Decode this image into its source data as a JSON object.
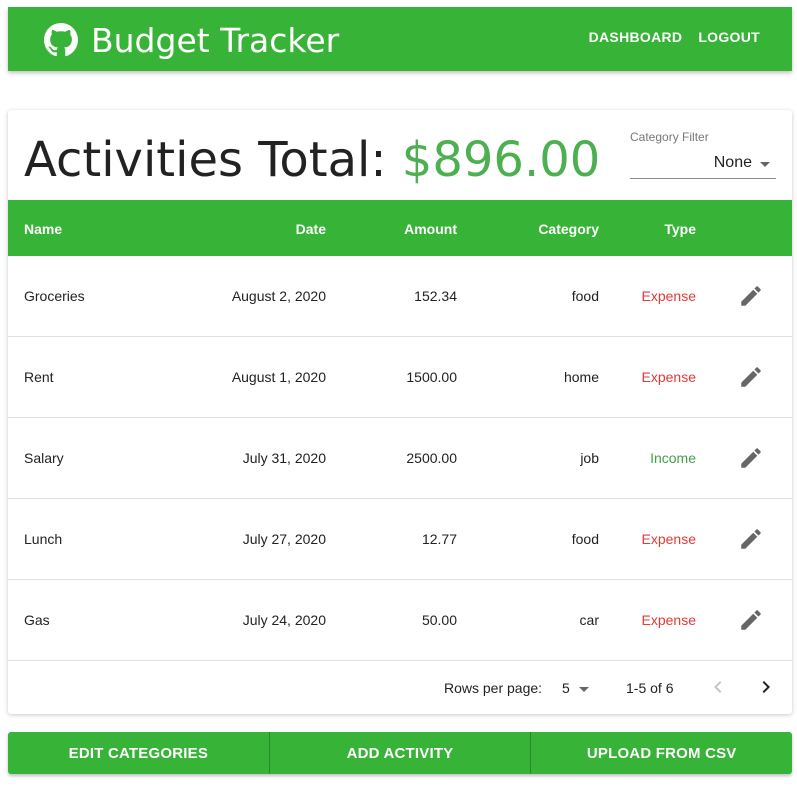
{
  "header": {
    "title": "Budget Tracker",
    "logo_icon": "github-icon",
    "nav": [
      "DASHBOARD",
      "LOGOUT"
    ],
    "color": "#37b337"
  },
  "summary": {
    "label": "Activities Total:",
    "amount": "$896.00",
    "amount_color": "#4caf50"
  },
  "filter": {
    "label": "Category Filter",
    "value": "None"
  },
  "table": {
    "columns": [
      "Name",
      "Date",
      "Amount",
      "Category",
      "Type"
    ],
    "rows": [
      {
        "name": "Groceries",
        "date": "August 2, 2020",
        "amount": "152.34",
        "category": "food",
        "type": "Expense"
      },
      {
        "name": "Rent",
        "date": "August 1, 2020",
        "amount": "1500.00",
        "category": "home",
        "type": "Expense"
      },
      {
        "name": "Salary",
        "date": "July 31, 2020",
        "amount": "2500.00",
        "category": "job",
        "type": "Income"
      },
      {
        "name": "Lunch",
        "date": "July 27, 2020",
        "amount": "12.77",
        "category": "food",
        "type": "Expense"
      },
      {
        "name": "Gas",
        "date": "July 24, 2020",
        "amount": "50.00",
        "category": "car",
        "type": "Expense"
      }
    ],
    "edit_icon": "pencil-icon",
    "type_colors": {
      "Expense": "#e53935",
      "Income": "#43a047"
    }
  },
  "pagination": {
    "rows_per_page_label": "Rows per page:",
    "rows_per_page": "5",
    "range": "1-5 of 6"
  },
  "actions": [
    "EDIT CATEGORIES",
    "ADD ACTIVITY",
    "UPLOAD FROM CSV"
  ]
}
